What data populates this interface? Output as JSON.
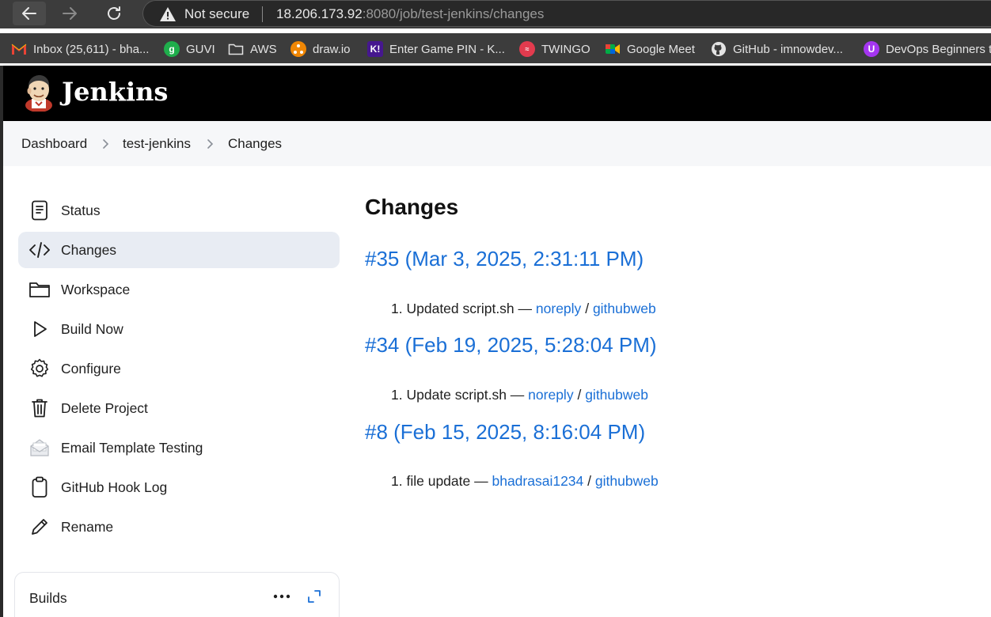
{
  "browser": {
    "not_secure": "Not secure",
    "url_host": "18.206.173.92",
    "url_rest": ":8080/job/test-jenkins/changes",
    "bookmarks": [
      {
        "label": "Inbox (25,611) - bha...",
        "icon": "gmail-icon"
      },
      {
        "label": "GUVI",
        "icon": "guvi-icon"
      },
      {
        "label": "AWS",
        "icon": "folder-icon"
      },
      {
        "label": "draw.io",
        "icon": "drawio-icon"
      },
      {
        "label": "Enter Game PIN - K...",
        "icon": "kahoot-icon"
      },
      {
        "label": "TWINGO",
        "icon": "twingo-icon"
      },
      {
        "label": "Google Meet",
        "icon": "meet-icon"
      },
      {
        "label": "GitHub - imnowdev...",
        "icon": "github-icon"
      },
      {
        "label": "DevOps Beginners t...",
        "icon": "devops-icon"
      }
    ]
  },
  "header": {
    "title": "Jenkins"
  },
  "breadcrumb": [
    "Dashboard",
    "test-jenkins",
    "Changes"
  ],
  "sidebar": {
    "items": [
      {
        "label": "Status",
        "icon": "status-icon"
      },
      {
        "label": "Changes",
        "icon": "code-icon"
      },
      {
        "label": "Workspace",
        "icon": "folder-icon"
      },
      {
        "label": "Build Now",
        "icon": "play-icon"
      },
      {
        "label": "Configure",
        "icon": "gear-icon"
      },
      {
        "label": "Delete Project",
        "icon": "trash-icon"
      },
      {
        "label": "Email Template Testing",
        "icon": "envelope-icon"
      },
      {
        "label": "GitHub Hook Log",
        "icon": "clipboard-icon"
      },
      {
        "label": "Rename",
        "icon": "pencil-icon"
      }
    ],
    "builds_title": "Builds"
  },
  "main": {
    "title": "Changes",
    "builds": [
      {
        "heading": "#35 (Mar 3, 2025, 2:31:11 PM)",
        "num": "1.",
        "msg": "Updated script.sh —",
        "author": "noreply",
        "sep": "/",
        "link": "githubweb"
      },
      {
        "heading": "#34 (Feb 19, 2025, 5:28:04 PM)",
        "num": "1.",
        "msg": "Update script.sh —",
        "author": "noreply",
        "sep": "/",
        "link": "githubweb"
      },
      {
        "heading": "#8 (Feb 15, 2025, 8:16:04 PM)",
        "num": "1.",
        "msg": "file update —",
        "author": "bhadrasai1234",
        "sep": "/",
        "link": "githubweb"
      }
    ]
  },
  "colors": {
    "link": "#1a6fd6",
    "header_bg": "#000000",
    "active_bg": "#e8ecf3"
  }
}
